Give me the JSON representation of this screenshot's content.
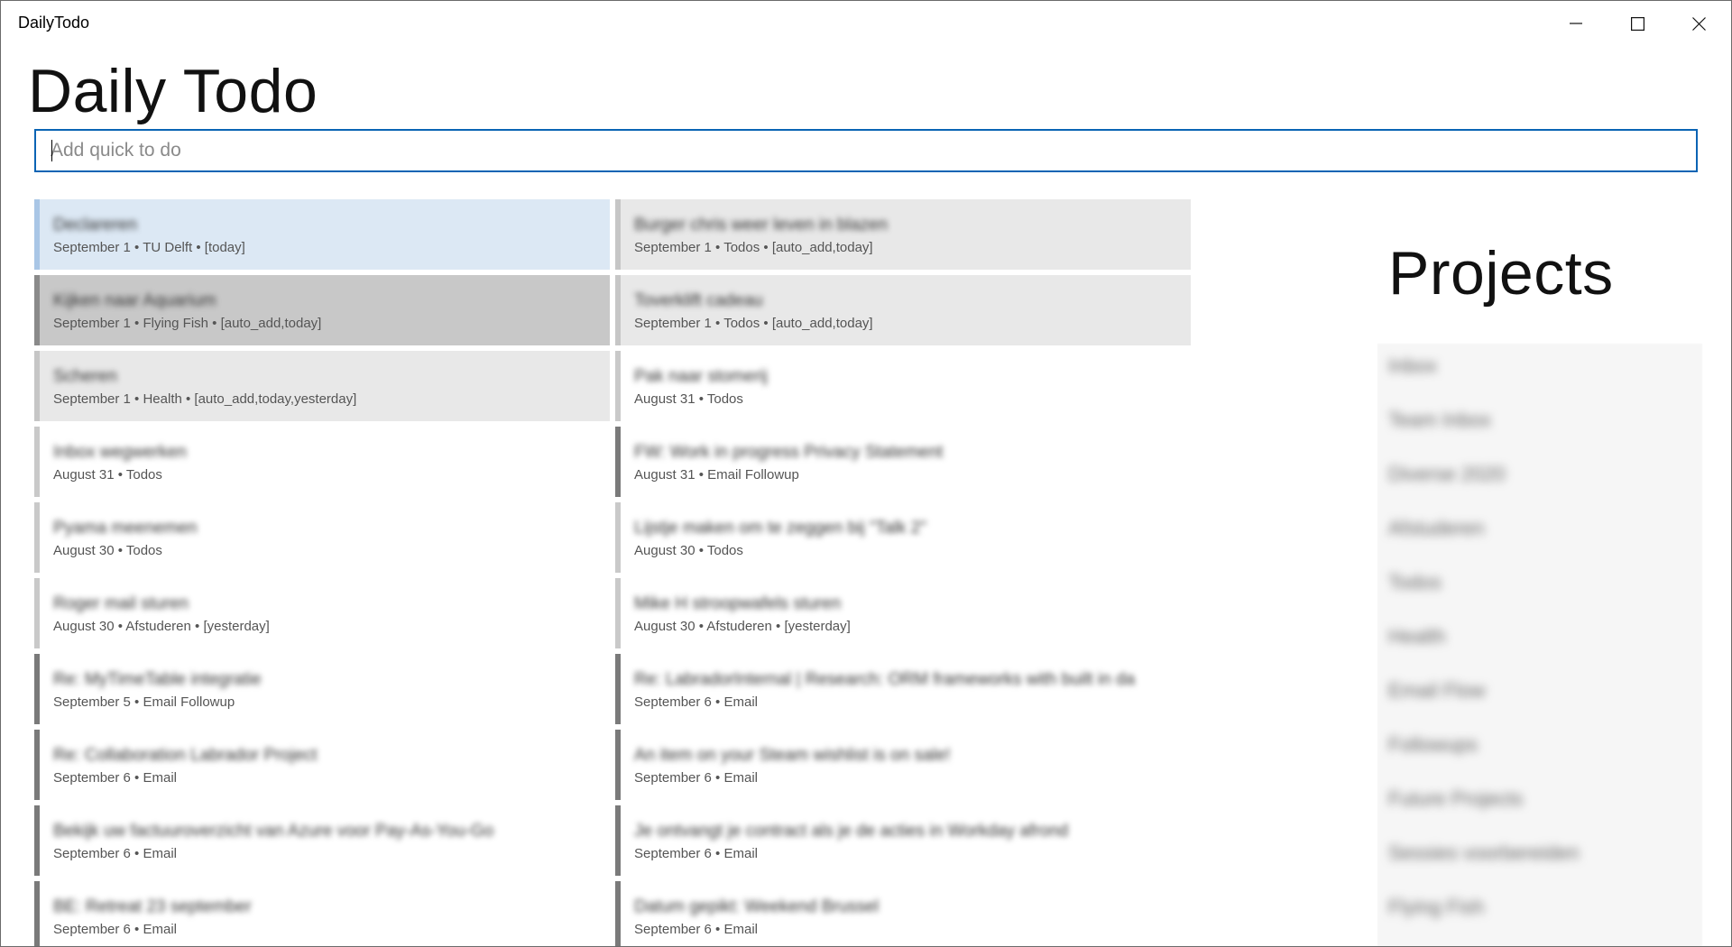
{
  "window": {
    "title": "DailyTodo"
  },
  "header": {
    "title": "Daily Todo"
  },
  "quick_add": {
    "placeholder": "Add quick to do",
    "value": ""
  },
  "todos": [
    {
      "title": "Declareren",
      "meta": "September 1 • TU Delft • [today]"
    },
    {
      "title": "Burger chris weer leven in blazen",
      "meta": "September 1 • Todos • [auto_add,today]"
    },
    {
      "title": "Kijken naar Aquarium",
      "meta": "September 1 • Flying Fish • [auto_add,today]"
    },
    {
      "title": "Toverklift cadeau",
      "meta": "September 1 • Todos • [auto_add,today]"
    },
    {
      "title": "Scheren",
      "meta": "September 1 • Health • [auto_add,today,yesterday]"
    },
    {
      "title": "Pak naar stomerij",
      "meta": "August 31 • Todos"
    },
    {
      "title": "Inbox wegwerken",
      "meta": "August 31 • Todos"
    },
    {
      "title": "FW: Work in progress Privacy Statement",
      "meta": "August 31 • Email Followup"
    },
    {
      "title": "Pyama meenemen",
      "meta": "August 30 • Todos"
    },
    {
      "title": "Lijstje maken om te zeggen bij \"Talk 2\"",
      "meta": "August 30 • Todos"
    },
    {
      "title": "Roger mail sturen",
      "meta": "August 30 • Afstuderen • [yesterday]"
    },
    {
      "title": "Mike H stroopwafels sturen",
      "meta": "August 30 • Afstuderen • [yesterday]"
    },
    {
      "title": "Re: MyTimeTable integratie",
      "meta": "September 5 • Email Followup"
    },
    {
      "title": "Re: LabradorInternal | Research: ORM frameworks with built in da",
      "meta": "September 6 • Email"
    },
    {
      "title": "Re: Collaboration Labrador Project",
      "meta": "September 6 • Email"
    },
    {
      "title": "An item on your Steam wishlist is on sale!",
      "meta": "September 6 • Email"
    },
    {
      "title": "Bekijk uw factuuroverzicht van Azure voor Pay-As-You-Go",
      "meta": "September 6 • Email"
    },
    {
      "title": "Je ontvangt je contract als je de acties in Workday afrond",
      "meta": "September 6 • Email"
    },
    {
      "title": "BE: Retreat 23 september",
      "meta": "September 6 • Email"
    },
    {
      "title": "Datum gepikt: Weekend Brussel",
      "meta": "September 6 • Email"
    }
  ],
  "projects": {
    "title": "Projects",
    "items": [
      "Inbox",
      "Team Inbox",
      "Diverse 2020",
      "Afstuderen",
      "Todos",
      "Health",
      "Email Flow",
      "Followups",
      "Future Projects",
      "Sessies voorbereiden",
      "Flying Fish"
    ]
  }
}
